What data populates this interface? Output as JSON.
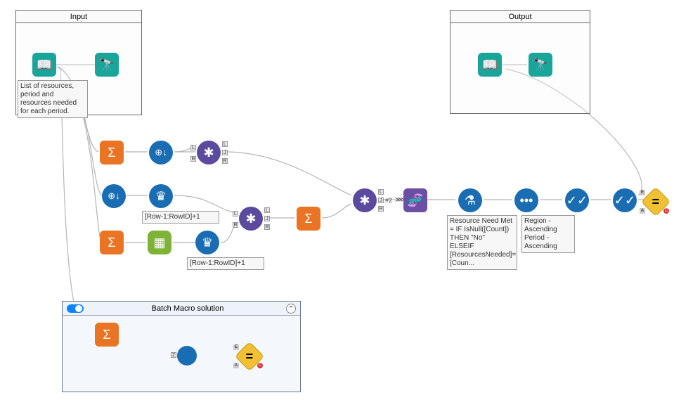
{
  "containers": {
    "input": {
      "title": "Input"
    },
    "output": {
      "title": "Output"
    }
  },
  "annotations": {
    "input_note": "List of resources, period and resources needed for each period.",
    "row_formula_1": "[Row-1:RowID]+1",
    "row_formula_2": "[Row-1:RowID]+1",
    "formula_note": "Resource Need Met = IF IsNull([Count]) THEN \"No\"\nELSEIF [ResourcesNeeded]=[Coun...",
    "sort_note": "Region - Ascending\nPeriod - Ascending"
  },
  "macro": {
    "title": "Batch Macro solution"
  },
  "labels": {
    "join_num": "#2",
    "arrow": "⋙",
    "L": "L",
    "J": "J",
    "R": "R",
    "E": "E",
    "A": "A",
    "C": "C"
  },
  "icons": {
    "book": "📖",
    "binoculars": "🔭",
    "sigma": "Σ",
    "plus_down": "⊕↓",
    "crown": "♛",
    "grid": "▦",
    "join": "✱",
    "dna": "🧬",
    "flask": "⚗",
    "dots": "•••",
    "check": "✓✓",
    "equals": "="
  }
}
